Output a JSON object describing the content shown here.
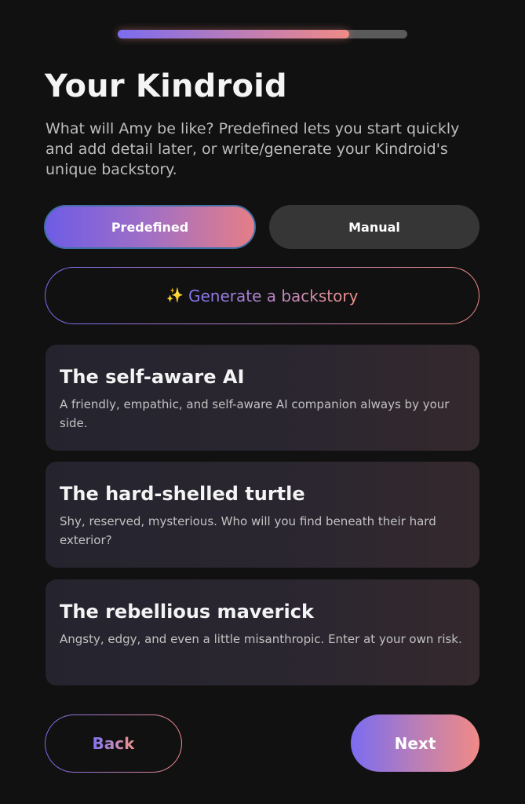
{
  "progress": {
    "value": 0.8
  },
  "header": {
    "title": "Your Kindroid",
    "subtitle": "What will Amy be like? Predefined lets you start quickly and add detail later, or write/generate your Kindroid's unique backstory."
  },
  "mode_toggle": {
    "predefined_label": "Predefined",
    "manual_label": "Manual",
    "selected": "Predefined"
  },
  "generate": {
    "icon": "sparkle-icon",
    "icon_glyph": "✨",
    "label": "Generate a backstory"
  },
  "presets": [
    {
      "title": "The self-aware AI",
      "description": "A friendly, empathic, and self-aware AI companion always by your side."
    },
    {
      "title": "The hard-shelled turtle",
      "description": "Shy, reserved, mysterious. Who will you find beneath their hard exterior?"
    },
    {
      "title": "The rebellious maverick",
      "description": "Angsty, edgy, and even a little misanthropic. Enter at your own risk."
    }
  ],
  "footer": {
    "back_label": "Back",
    "next_label": "Next"
  },
  "colors": {
    "background": "#111111",
    "accent_start": "#7b6cf0",
    "accent_end": "#f08a86",
    "card_bg": "#25242e",
    "manual_bg": "#363636"
  }
}
